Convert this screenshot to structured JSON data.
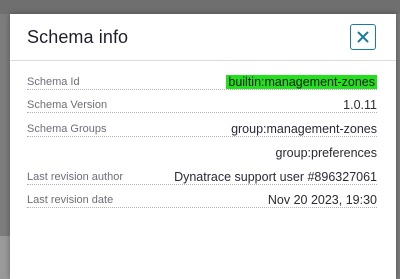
{
  "dialog": {
    "title": "Schema info",
    "close_icon": "close-icon"
  },
  "colors": {
    "accent": "#1a7aa5",
    "highlight": "#22e01b"
  },
  "fields": [
    {
      "label": "Schema Id",
      "value": "builtin:management-zones"
    },
    {
      "label": "Schema Version",
      "value": "1.0.11"
    },
    {
      "label": "Schema Groups",
      "value": "group:management-zones",
      "extra_value": "group:preferences"
    },
    {
      "label": "Last revision author",
      "value": "Dynatrace support user #896327061"
    },
    {
      "label": "Last revision date",
      "value": "Nov 20 2023, 19:30"
    }
  ]
}
